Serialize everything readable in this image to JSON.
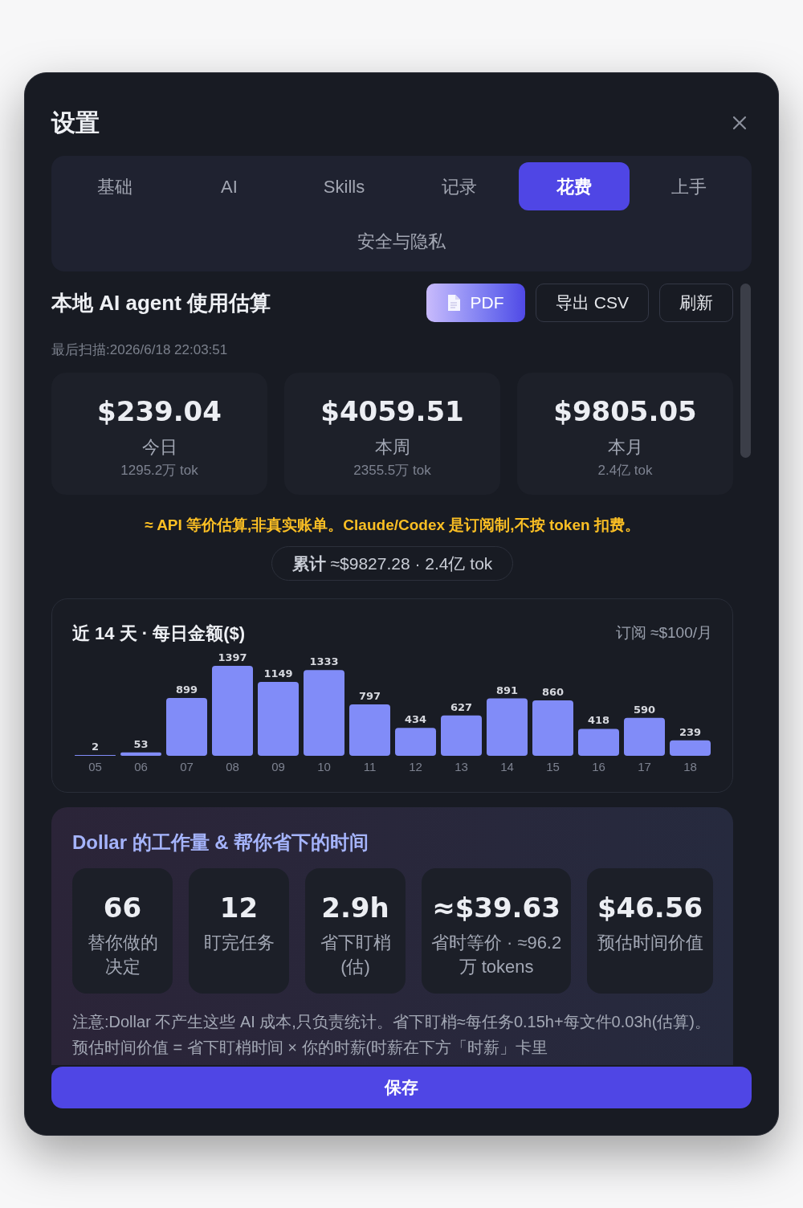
{
  "dialog": {
    "title": "设置"
  },
  "tabs": [
    {
      "label": "基础",
      "selected": false
    },
    {
      "label": "AI",
      "selected": false
    },
    {
      "label": "Skills",
      "selected": false
    },
    {
      "label": "记录",
      "selected": false
    },
    {
      "label": "花费",
      "selected": true
    },
    {
      "label": "上手",
      "selected": false
    },
    {
      "label": "安全与隐私",
      "selected": false
    }
  ],
  "usage": {
    "title": "本地 AI agent 使用估算",
    "actions": [
      {
        "label": "PDF",
        "kind": "primary"
      },
      {
        "label": "导出 CSV",
        "kind": "outline"
      },
      {
        "label": "刷新",
        "kind": "outline"
      }
    ],
    "last_scan": "最后扫描:2026/6/18 22:03:51",
    "stats": [
      {
        "value": "$239.04",
        "label": "今日",
        "tokens": "1295.2万 tok"
      },
      {
        "value": "$4059.51",
        "label": "本周",
        "tokens": "2355.5万 tok"
      },
      {
        "value": "$9805.05",
        "label": "本月",
        "tokens": "2.4亿 tok"
      }
    ],
    "disclaimer": "≈ API 等价估算,非真实账单。Claude/Codex 是订阅制,不按 token 扣费。",
    "total": "**累计** ≈$9827.28 · 2.4亿 tok"
  },
  "daily_chart": {
    "title": "近 14 天 · 每日金额($)",
    "subscription": "订阅 ≈$100/月",
    "chart_data": {
      "type": "bar",
      "categories": [
        "05",
        "06",
        "07",
        "08",
        "09",
        "10",
        "11",
        "12",
        "13",
        "14",
        "15",
        "16",
        "17",
        "18"
      ],
      "values": [
        2,
        53,
        899,
        1397,
        1149,
        1333,
        797,
        434,
        627,
        891,
        860,
        418,
        590,
        239
      ],
      "data_labels": true
    }
  },
  "workload": {
    "title": "Dollar 的工作量 & 帮你省下的时间",
    "metrics": [
      {
        "value": "66",
        "label": "替你做的决定"
      },
      {
        "value": "12",
        "label": "盯完任务"
      },
      {
        "value": "2.9h",
        "label": "省下盯梢(估)"
      },
      {
        "value": "≈$39.63",
        "label": "省时等价 · ≈96.2万 tokens"
      },
      {
        "value": "$46.56",
        "label": "预估时间价值"
      }
    ],
    "note": "注意:Dollar 不产生这些 AI 成本,只负责统计。省下盯梢≈每任务0.15h+每文件0.03h(估算)。预估时间价值 = 省下盯梢时间 × 你的时薪(时薪在下方「时薪」卡里"
  },
  "save_button": "保存"
}
